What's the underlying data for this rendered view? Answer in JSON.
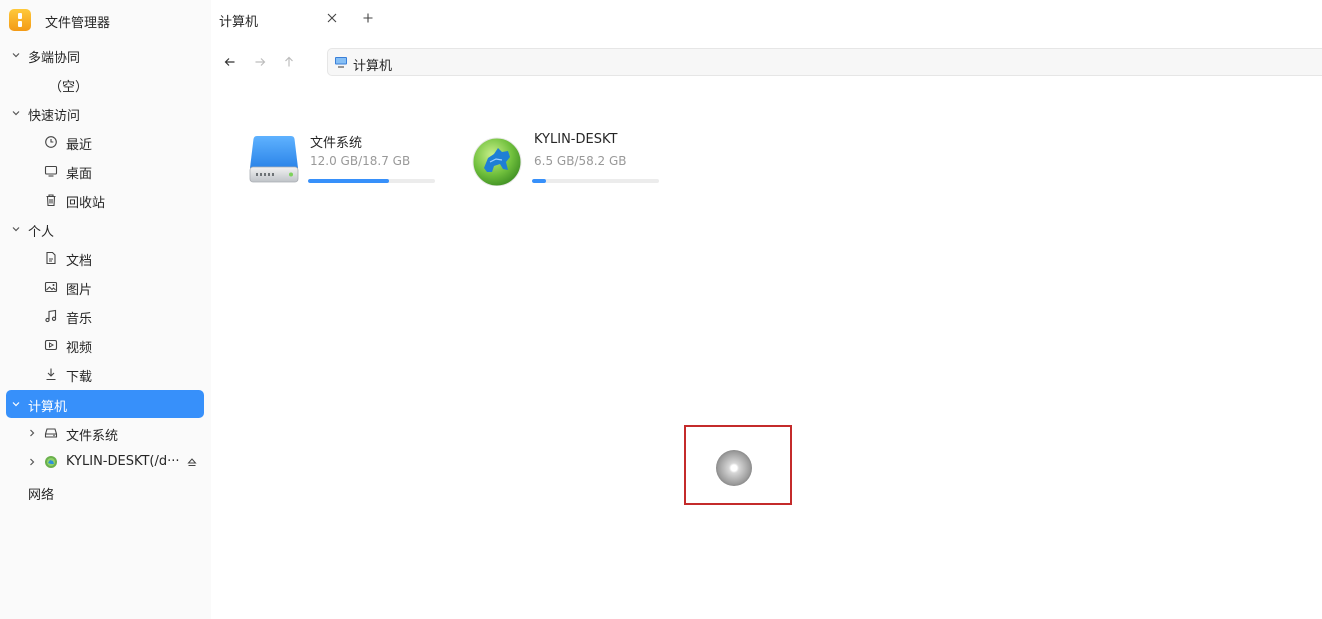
{
  "app": {
    "title": "文件管理器"
  },
  "sidebar": {
    "groups": [
      {
        "label": "多端协同",
        "items": [
          {
            "label": "（空）"
          }
        ]
      },
      {
        "label": "快速访问",
        "items": [
          {
            "label": "最近",
            "icon": "clock-icon"
          },
          {
            "label": "桌面",
            "icon": "monitor-icon"
          },
          {
            "label": "回收站",
            "icon": "trash-icon"
          }
        ]
      },
      {
        "label": "个人",
        "items": [
          {
            "label": "文档",
            "icon": "document-icon"
          },
          {
            "label": "图片",
            "icon": "image-icon"
          },
          {
            "label": "音乐",
            "icon": "music-icon"
          },
          {
            "label": "视频",
            "icon": "video-icon"
          },
          {
            "label": "下载",
            "icon": "download-icon"
          }
        ]
      },
      {
        "label": "计算机",
        "selected": true,
        "items": [
          {
            "label": "文件系统",
            "icon": "drive-icon"
          },
          {
            "label": "KYLIN-DESKT(/d···",
            "icon": "disc-icon"
          }
        ]
      },
      {
        "label": "网络"
      }
    ]
  },
  "tabs": [
    {
      "label": "计算机"
    }
  ],
  "address": {
    "path": "计算机"
  },
  "drives": [
    {
      "name": "文件系统",
      "usage": "12.0 GB/18.7 GB",
      "used_fraction": 0.64
    },
    {
      "name": "KYLIN-DESKT",
      "usage": "6.5 GB/58.2 GB",
      "used_fraction": 0.11
    }
  ],
  "colors": {
    "accent": "#3790fa",
    "highlight": "#c42b2b"
  }
}
